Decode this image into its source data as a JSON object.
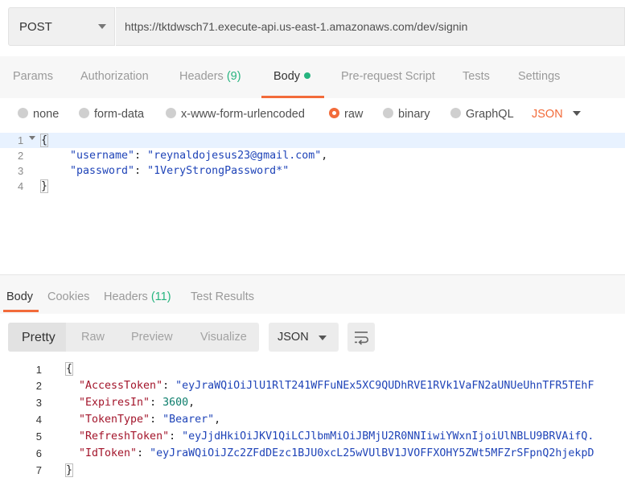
{
  "request": {
    "method": "POST",
    "url": "https://tktdwsch71.execute-api.us-east-1.amazonaws.com/dev/signin"
  },
  "request_tabs": [
    {
      "label": "Params"
    },
    {
      "label": "Authorization"
    },
    {
      "label": "Headers",
      "count": "(9)"
    },
    {
      "label": "Body"
    },
    {
      "label": "Pre-request Script"
    },
    {
      "label": "Tests"
    },
    {
      "label": "Settings"
    }
  ],
  "body_types": {
    "options": [
      "none",
      "form-data",
      "x-www-form-urlencoded",
      "raw",
      "binary",
      "GraphQL"
    ],
    "selected": "raw",
    "format": "JSON"
  },
  "editor": {
    "line_numbers": [
      "1",
      "2",
      "3",
      "4"
    ],
    "open_brace": "{",
    "close_brace": "}",
    "key1": "\"username\"",
    "val1": "\"reynaldojesus23@gmail.com\"",
    "key2": "\"password\"",
    "val2": "\"1VeryStrongPassword*\"",
    "colon": ": ",
    "comma": ","
  },
  "response_tabs": [
    {
      "label": "Body"
    },
    {
      "label": "Cookies"
    },
    {
      "label": "Headers",
      "count": "(11)"
    },
    {
      "label": "Test Results"
    }
  ],
  "response_view": {
    "modes": [
      "Pretty",
      "Raw",
      "Preview",
      "Visualize"
    ],
    "selected": "Pretty",
    "format": "JSON"
  },
  "response": {
    "line_numbers": [
      "1",
      "2",
      "3",
      "4",
      "5",
      "6",
      "7"
    ],
    "open_brace": "{",
    "close_brace": "}",
    "k_access": "\"AccessToken\"",
    "v_access": "\"eyJraWQiOiJlU1RlT241WFFuNEx5XC9QUDhRVE1RVk1VaFN2aUNUeUhnTFR5TEhF",
    "k_expires": "\"ExpiresIn\"",
    "v_expires": "3600",
    "k_type": "\"TokenType\"",
    "v_type": "\"Bearer\"",
    "k_refresh": "\"RefreshToken\"",
    "v_refresh": "\"eyJjdHkiOiJKV1QiLCJlbmMiOiJBMjU2R0NNIiwiYWxnIjoiUlNBLU9BRVAifQ.",
    "k_id": "\"IdToken\"",
    "v_id": "\"eyJraWQiOiJZc2ZFdDEzc1BJU0xcL25wVUlBV1JVOFFXOHY5ZWt5MFZrSFpnQ2hjekpD",
    "colon": ": ",
    "comma": ","
  }
}
